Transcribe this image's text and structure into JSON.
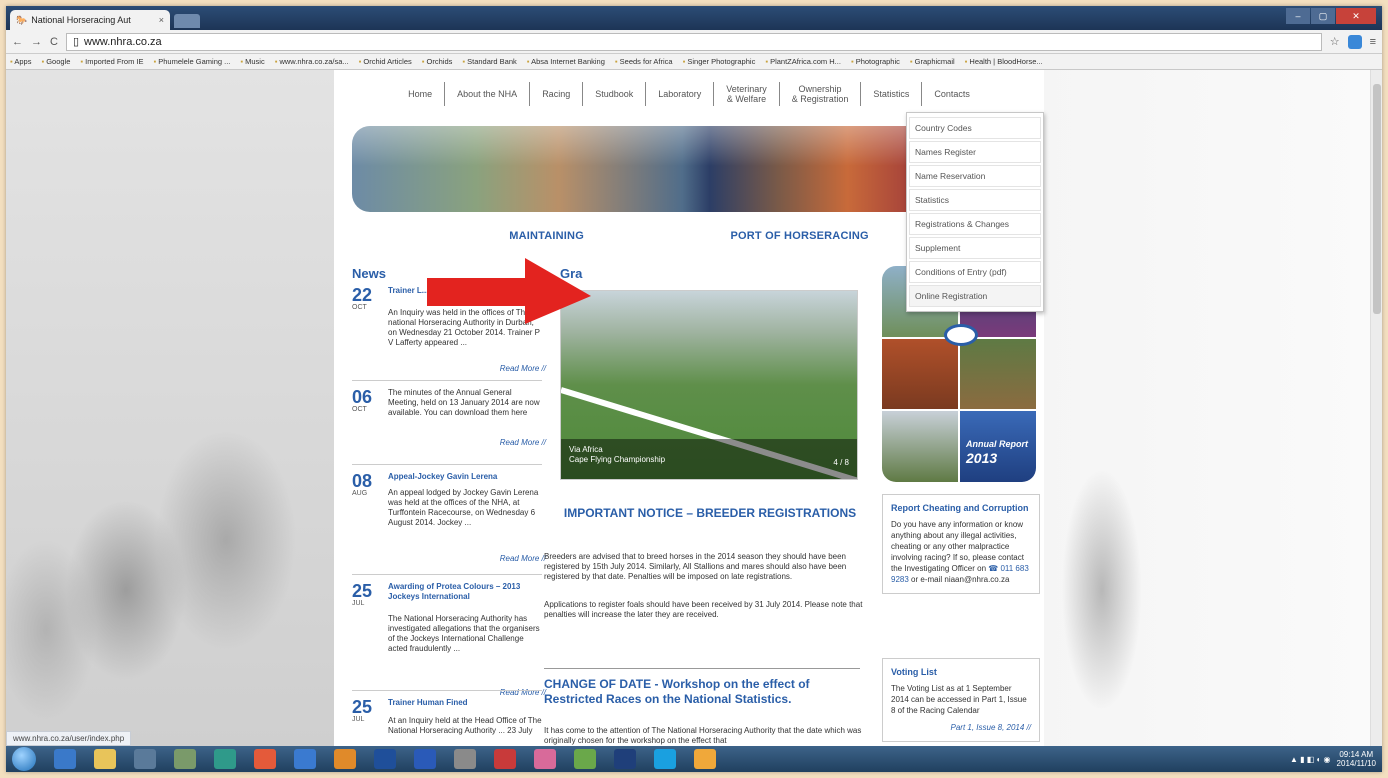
{
  "browser": {
    "tab_title": "National Horseracing Aut",
    "tab_close": "×",
    "url": "www.nhra.co.za",
    "bookmarks": [
      "Apps",
      "Google",
      "Imported From IE",
      "Phumelele Gaming ...",
      "Music",
      "www.nhra.co.za/sa...",
      "Orchid Articles",
      "Orchids",
      "Standard Bank",
      "Absa Internet Banking",
      "Seeds for Africa",
      "Singer Photographic",
      "PlantZAfrica.com H...",
      "Photographic",
      "Graphicmail",
      "Health | BloodHorse..."
    ],
    "status_url": "www.nhra.co.za/user/index.php"
  },
  "nav": {
    "items": [
      {
        "label": "Home"
      },
      {
        "label": "About the NHA"
      },
      {
        "label": "Racing"
      },
      {
        "label": "Studbook"
      },
      {
        "label": "Laboratory"
      },
      {
        "label": "Veterinary\n& Welfare"
      },
      {
        "label": "Ownership\n& Registration"
      },
      {
        "label": "Statistics"
      },
      {
        "label": "Contacts"
      }
    ]
  },
  "studbook_menu": {
    "items": [
      "Country Codes",
      "Names Register",
      "Name Reservation",
      "Statistics",
      "Registrations & Changes",
      "Supplement",
      "Conditions of Entry (pdf)",
      "Online Registration"
    ]
  },
  "tagline": "MAINTAINING ... PORT OF HORSERACING",
  "tagline_left": "MAINTAINING",
  "tagline_right": "PORT OF HORSERACING",
  "news": {
    "heading": "News",
    "items": [
      {
        "day": "22",
        "month": "OCT",
        "title": "Trainer L...",
        "body": "An Inquiry was held in the offices of The national Horseracing Authority in Durban, on Wednesday 21 October 2014. Trainer P V Lafferty appeared ...",
        "more": "Read More //"
      },
      {
        "day": "06",
        "month": "OCT",
        "title": "",
        "body": "The minutes of the Annual General Meeting, held on 13 January 2014 are now available. You can download them here",
        "more": "Read More //"
      },
      {
        "day": "08",
        "month": "AUG",
        "title": "Appeal-Jockey Gavin Lerena",
        "body": "An appeal lodged by Jockey Gavin Lerena was held at the offices of the NHA, at Turffontein Racecourse, on Wednesday 6 August 2014. Jockey ...",
        "more": "Read More //"
      },
      {
        "day": "25",
        "month": "JUL",
        "title": "Awarding of Protea Colours – 2013 Jockeys International",
        "body": "The National Horseracing Authority has investigated allegations that the organisers of the Jockeys International Challenge acted fraudulently ...",
        "more": "Read More //"
      },
      {
        "day": "25",
        "month": "JUL",
        "title": "Trainer Human Fined",
        "body": "At an Inquiry held at the Head Office of The National Horseracing Authority ... 23 July",
        "more": ""
      }
    ]
  },
  "gallery": {
    "heading": "Gra",
    "caption_line1": "Via Africa",
    "caption_line2": "Cape Flying Championship",
    "counter": "4 / 8"
  },
  "notice": {
    "heading": "IMPORTANT NOTICE – BREEDER REGISTRATIONS",
    "para1": "Breeders are advised that to breed horses in the 2014 season they should have been registered by 15th July 2014. Similarly, All Stallions and mares should also have been registered by that date. Penalties will be imposed on late registrations.",
    "para2": "Applications to register foals should have been received by 31 July 2014. Please note that penalties will increase the later they are received."
  },
  "change": {
    "heading": "CHANGE OF DATE - Workshop on the effect of Restricted Races on the National Statistics.",
    "body": "It has come to the attention of The National Horseracing Authority that the date which was originally chosen for the workshop on the effect that"
  },
  "annual_report": {
    "label": "Annual Report",
    "year": "2013"
  },
  "report_box": {
    "heading": "Report Cheating and Corruption",
    "body": "Do you have any information or know anything about any illegal activities, cheating or any other malpractice involving racing? If so, please contact the Investigating Officer on",
    "phone": "011 683 9283",
    "tail": "or e-mail niaan@nhra.co.za"
  },
  "voting_box": {
    "heading": "Voting List",
    "body": "The Voting List as at 1 September 2014 can be accessed in Part 1, Issue 8 of the Racing Calendar",
    "more": "Part 1, Issue 8, 2014 //"
  },
  "taskbar": {
    "time": "09:14 AM",
    "date": "2014/11/10"
  },
  "colors": {
    "accent_blue": "#2a5ea8",
    "arrow_red": "#e3231f"
  }
}
